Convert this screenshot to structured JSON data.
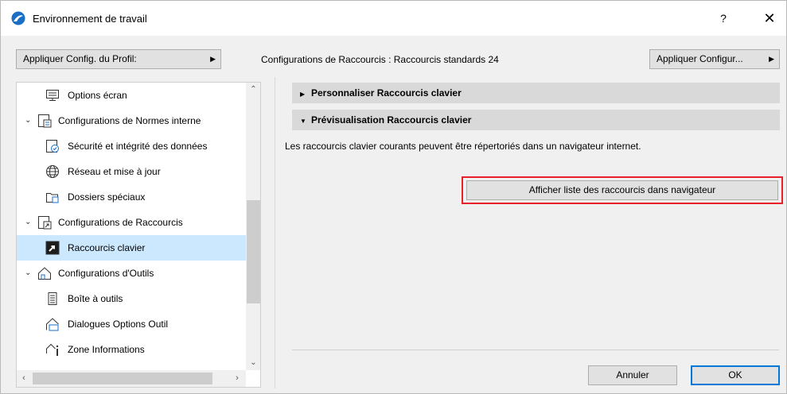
{
  "window": {
    "title": "Environnement de travail",
    "help_label": "?",
    "close_label": "✕"
  },
  "toolbar": {
    "apply_profile_label": "Appliquer Config. du Profil:",
    "config_label": "Configurations de Raccourcis :",
    "config_value": "Raccourcis standards 24",
    "apply_config_label": "Appliquer Configur..."
  },
  "tree": {
    "items": [
      {
        "label": "Options écran",
        "icon": "screen-icon",
        "expander": ""
      },
      {
        "label": "Configurations de Normes  interne",
        "icon": "standards-icon",
        "expander": "⌄"
      },
      {
        "label": "Sécurité et intégrité des données",
        "icon": "security-icon",
        "expander": ""
      },
      {
        "label": "Réseau et mise à jour",
        "icon": "globe-icon",
        "expander": ""
      },
      {
        "label": "Dossiers spéciaux",
        "icon": "folder-icon",
        "expander": ""
      },
      {
        "label": "Configurations de Raccourcis",
        "icon": "shortcuts-config-icon",
        "expander": "⌄"
      },
      {
        "label": "Raccourcis clavier",
        "icon": "shortcut-arrow-icon",
        "expander": ""
      },
      {
        "label": "Configurations d'Outils",
        "icon": "tools-config-icon",
        "expander": "⌄"
      },
      {
        "label": "Boîte à outils",
        "icon": "toolbox-icon",
        "expander": ""
      },
      {
        "label": "Dialogues Options Outil",
        "icon": "tool-dialog-icon",
        "expander": ""
      },
      {
        "label": "Zone Informations",
        "icon": "info-icon",
        "expander": ""
      }
    ],
    "selected_index": 6
  },
  "panel": {
    "section1": "Personnaliser Raccourcis clavier",
    "section2": "Prévisualisation Raccourcis clavier",
    "description": "Les raccourcis clavier courants peuvent être répertoriés dans un navigateur internet.",
    "show_button": "Afficher liste des raccourcis dans navigateur"
  },
  "actions": {
    "cancel": "Annuler",
    "ok": "OK"
  },
  "colors": {
    "selection": "#cce8ff",
    "highlight": "#e8202a",
    "accent": "#0078d7"
  }
}
